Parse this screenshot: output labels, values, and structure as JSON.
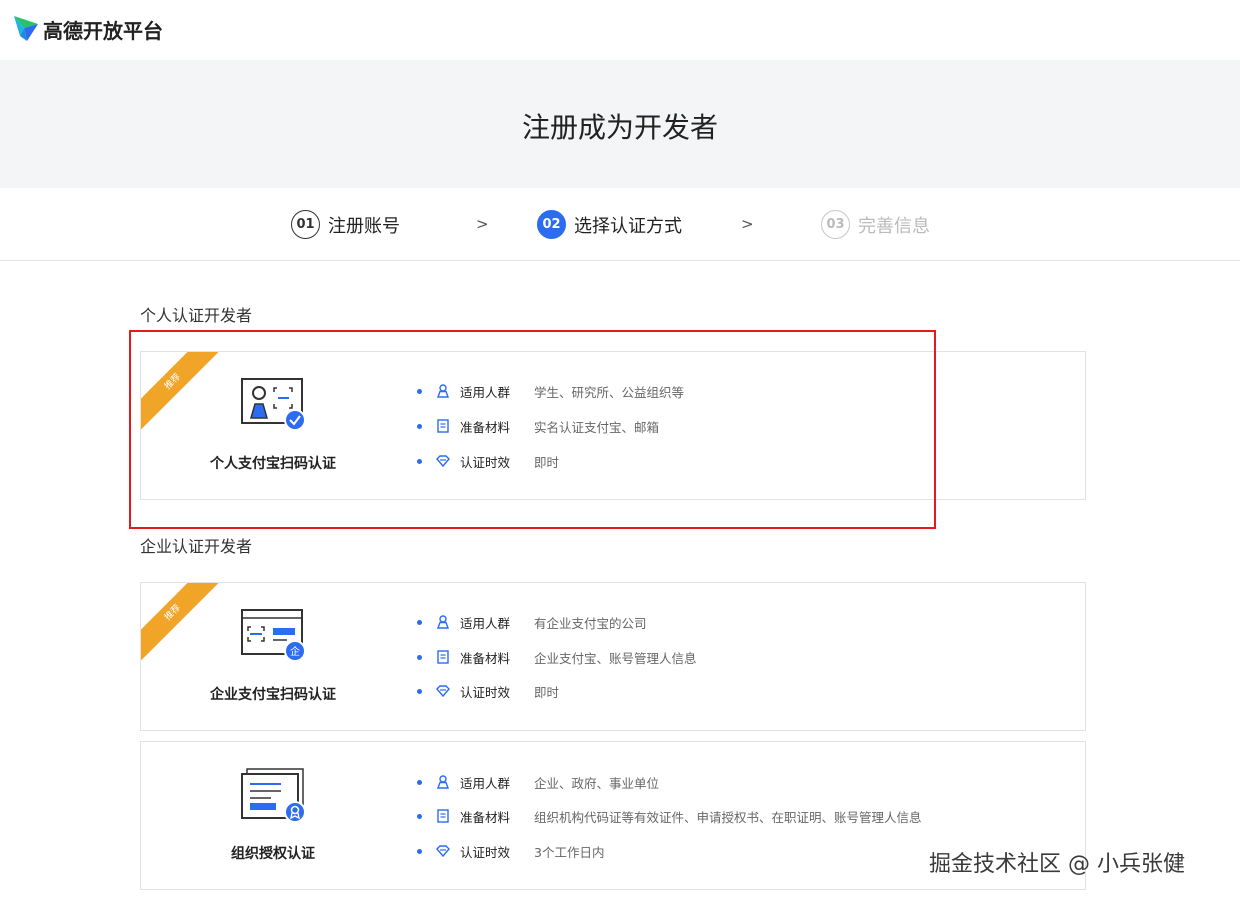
{
  "brand": {
    "logo_text": "高德开放平台",
    "accent": "#2b6cf0",
    "ribbon_color": "#f0a428",
    "highlight_color": "#e51b1b"
  },
  "hero": {
    "title": "注册成为开发者"
  },
  "steps": [
    {
      "num": "01",
      "label": "注册账号",
      "state": "done"
    },
    {
      "num": "02",
      "label": "选择认证方式",
      "state": "active"
    },
    {
      "num": "03",
      "label": "完善信息",
      "state": "pending"
    }
  ],
  "step_arrow": ">",
  "personal": {
    "title": "个人认证开发者",
    "cards": [
      {
        "badge": "推荐",
        "name": "个人支付宝扫码认证",
        "icon": "person-id-scan-icon",
        "rows": [
          {
            "icon": "user-icon",
            "label": "适用人群",
            "value": "学生、研究所、公益组织等"
          },
          {
            "icon": "document-icon",
            "label": "准备材料",
            "value": "实名认证支付宝、邮箱"
          },
          {
            "icon": "diamond-icon",
            "label": "认证时效",
            "value": "即时"
          }
        ]
      }
    ]
  },
  "enterprise": {
    "title": "企业认证开发者",
    "cards": [
      {
        "badge": "推荐",
        "name": "企业支付宝扫码认证",
        "icon": "enterprise-scan-icon",
        "rows": [
          {
            "icon": "user-icon",
            "label": "适用人群",
            "value": "有企业支付宝的公司"
          },
          {
            "icon": "document-icon",
            "label": "准备材料",
            "value": "企业支付宝、账号管理人信息"
          },
          {
            "icon": "diamond-icon",
            "label": "认证时效",
            "value": "即时"
          }
        ]
      },
      {
        "badge": "",
        "name": "组织授权认证",
        "icon": "organization-certificate-icon",
        "rows": [
          {
            "icon": "user-icon",
            "label": "适用人群",
            "value": "企业、政府、事业单位"
          },
          {
            "icon": "document-icon",
            "label": "准备材料",
            "value": "组织机构代码证等有效证件、申请授权书、在职证明、账号管理人信息"
          },
          {
            "icon": "diamond-icon",
            "label": "认证时效",
            "value": "3个工作日内"
          }
        ]
      }
    ]
  },
  "watermark": "掘金技术社区 @ 小兵张健"
}
